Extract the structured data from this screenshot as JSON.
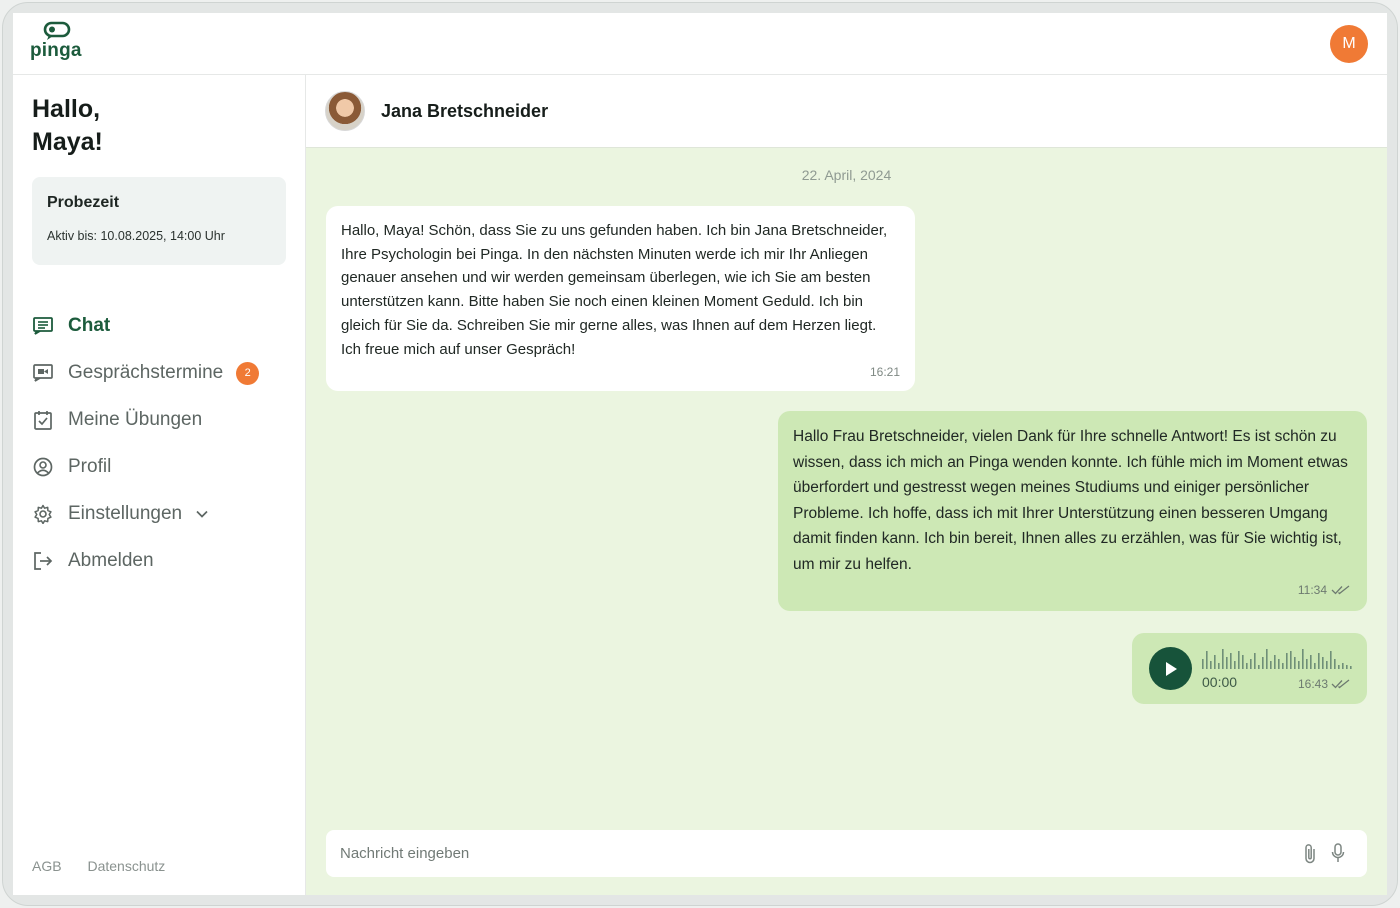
{
  "app": {
    "logo_text": "pinga",
    "user_initial": "M"
  },
  "sidebar": {
    "greeting": "Hallo, Maya!",
    "trial": {
      "title": "Probezeit",
      "active_until": "Aktiv bis: 10.08.2025, 14:00 Uhr"
    },
    "items": [
      {
        "label": "Chat",
        "icon": "chat-icon",
        "active": true
      },
      {
        "label": "Gesprächstermine",
        "icon": "video-icon",
        "badge": "2"
      },
      {
        "label": "Meine Übungen",
        "icon": "clipboard-check-icon"
      },
      {
        "label": "Profil",
        "icon": "user-circle-icon"
      },
      {
        "label": "Einstellungen",
        "icon": "gear-icon",
        "expandable": true
      },
      {
        "label": "Abmelden",
        "icon": "logout-icon"
      }
    ],
    "footer": {
      "agb": "AGB",
      "privacy": "Datenschutz"
    }
  },
  "chat": {
    "contact_name": "Jana Bretschneider",
    "date_separator": "22. April, 2024",
    "messages": [
      {
        "direction": "incoming",
        "text": "Hallo, Maya! Schön, dass Sie zu uns gefunden haben. Ich bin Jana Bretschneider, Ihre Psychologin bei Pinga. In den nächsten Minuten werde ich mir Ihr Anliegen genauer ansehen und wir werden gemeinsam überlegen, wie ich Sie am besten unterstützen kann. Bitte haben Sie noch einen kleinen Moment Geduld. Ich bin gleich für Sie da. Schreiben Sie mir gerne alles, was Ihnen auf dem Herzen liegt. Ich freue mich auf unser Gespräch!",
        "time": "16:21"
      },
      {
        "direction": "outgoing",
        "text": "Hallo Frau Bretschneider, vielen Dank für Ihre schnelle Antwort! Es ist schön zu wissen, dass ich mich an Pinga wenden konnte. Ich fühle mich im Moment etwas überfordert und gestresst wegen meines Studiums und einiger persönlicher Probleme. Ich hoffe, dass ich mit Ihrer Unterstützung einen besseren Umgang damit finden kann. Ich bin bereit, Ihnen alles zu erzählen, was für Sie wichtig ist, um mir zu helfen.",
        "time": "11:34",
        "status": "read"
      },
      {
        "direction": "outgoing",
        "type": "voice",
        "duration": "00:00",
        "time": "16:43",
        "status": "read"
      }
    ],
    "composer": {
      "placeholder": "Nachricht eingeben"
    }
  },
  "colors": {
    "brand_green": "#1c5b3c",
    "accent_orange": "#f07a35",
    "chat_background": "#ebf5e0",
    "outgoing_bubble": "#cde8b5"
  }
}
